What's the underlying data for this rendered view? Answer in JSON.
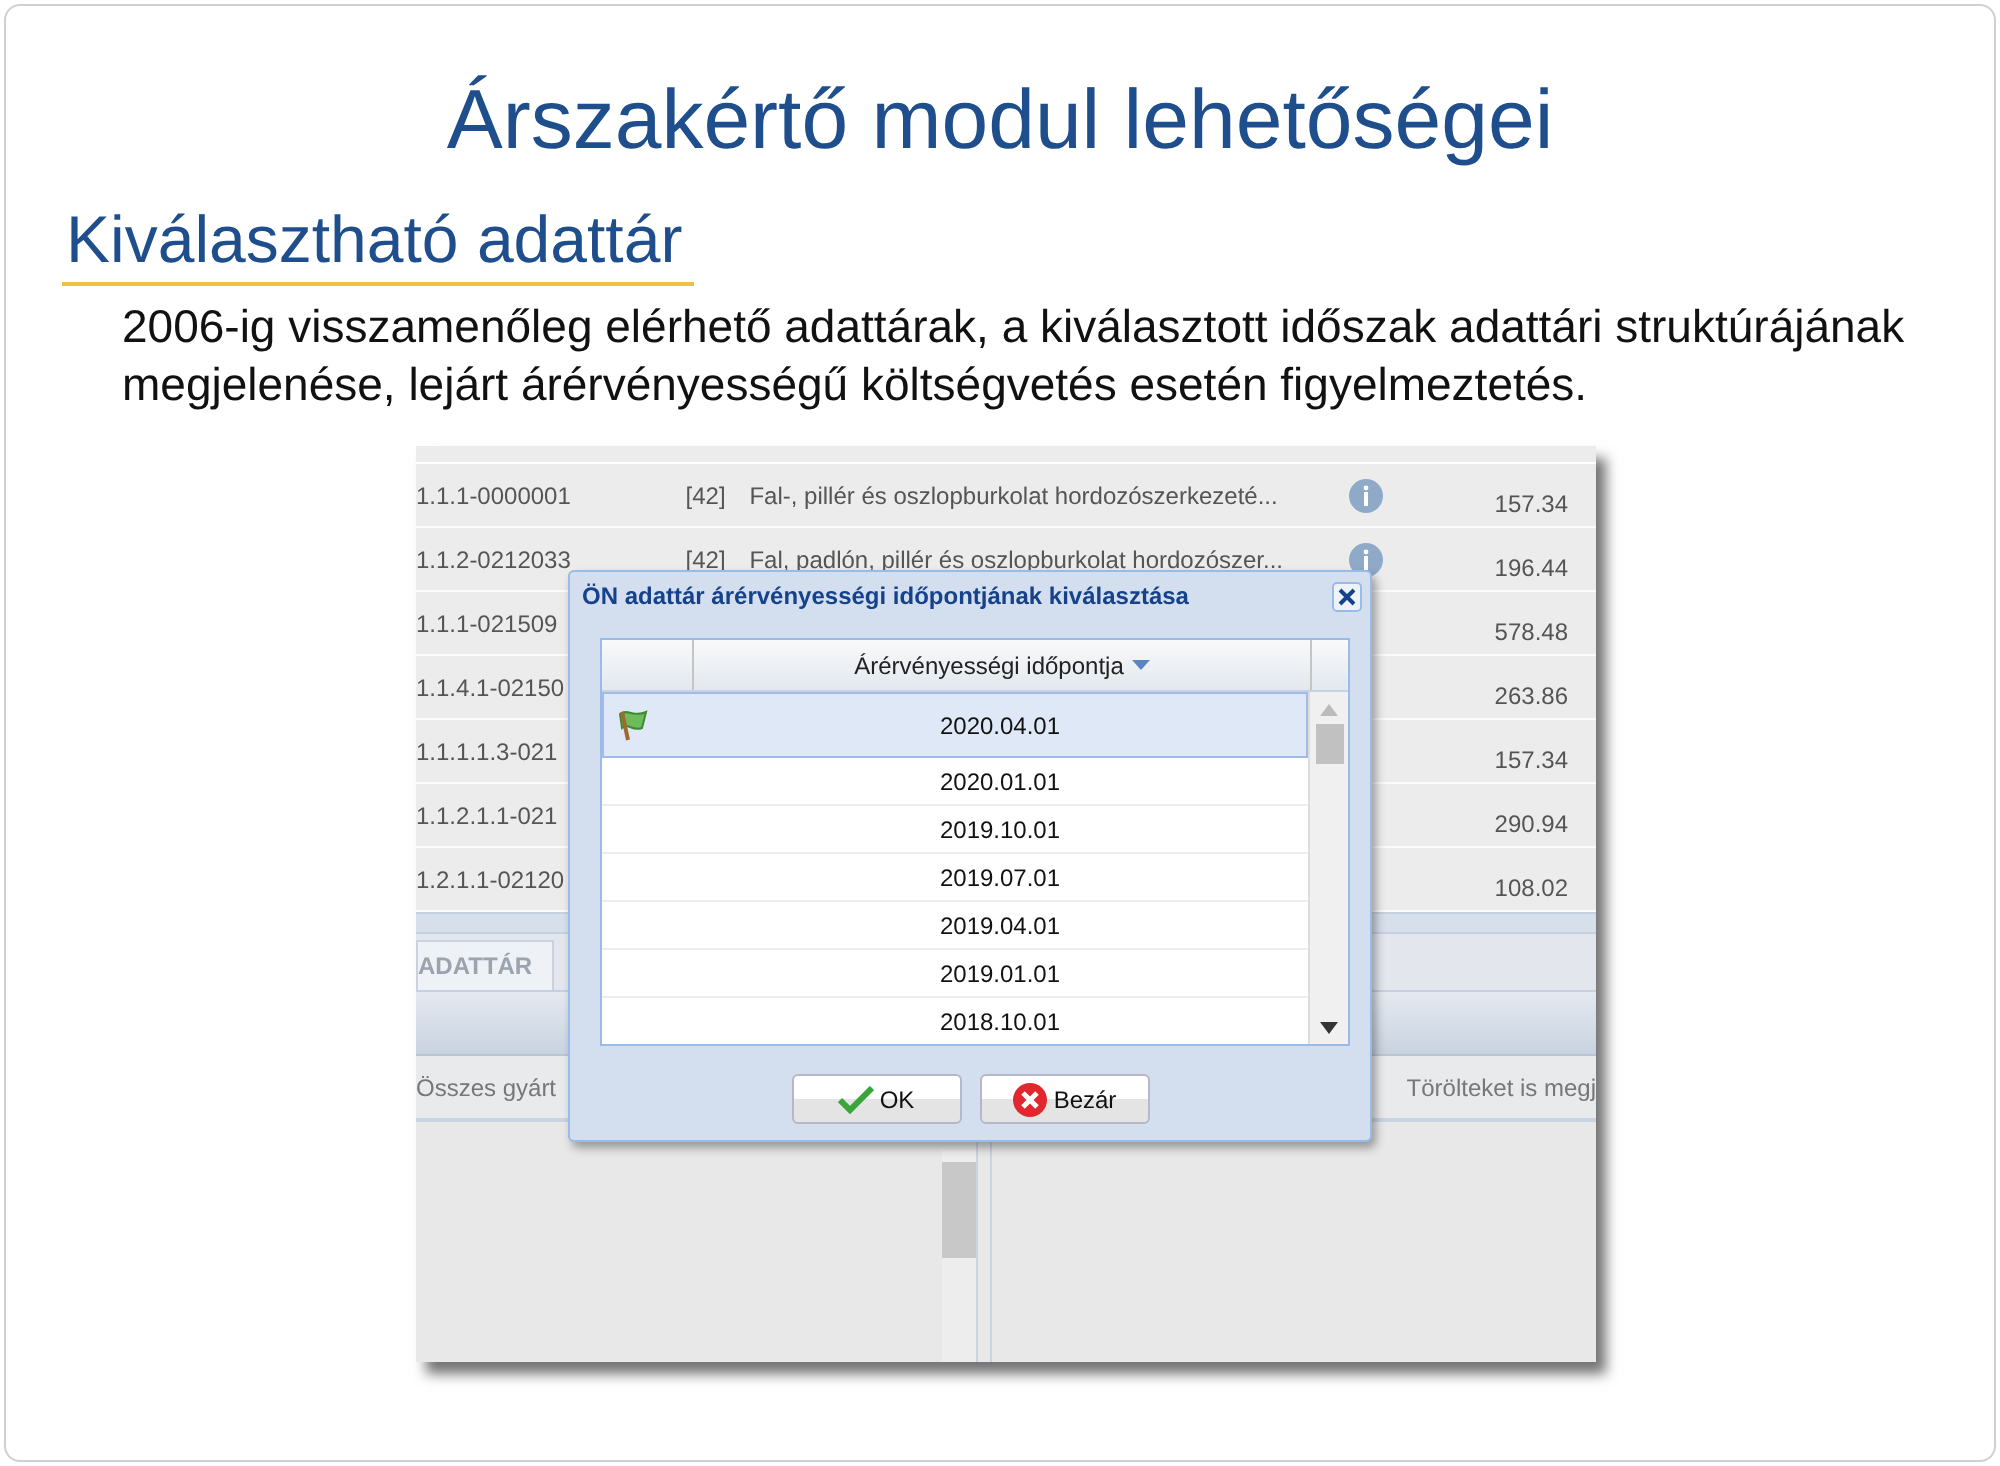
{
  "slide": {
    "title": "Árszakértő modul lehetőségei",
    "subtitle": "Kiválasztható adattár",
    "text": "2006-ig visszamenőleg elérhető adattárak, a kiválasztott időszak adattári struktúrájának megjelenése, lejárt árérvényességű költségvetés esetén figyelmeztetés."
  },
  "screenshot": {
    "rows": [
      {
        "code": "1.1.1-0000001",
        "group": "[42]",
        "description": "Fal-, pillér és oszlopburkolat hordozószerkezeté...",
        "price": "157.34"
      },
      {
        "code": "1.1.2-0212033",
        "group": "[42]",
        "description": "Fal, padlón, pillér és oszlopburkolat hordozószer...",
        "price": "196.44"
      },
      {
        "code": "1.1.1-021509",
        "price": "578.48"
      },
      {
        "code": "1.1.4.1-02150",
        "price": "263.86"
      },
      {
        "code": "1.1.1.1.3-021",
        "price": "157.34"
      },
      {
        "code": "1.1.2.1.1-021",
        "price": "290.94"
      },
      {
        "code": "1.2.1.1-02120",
        "price": "108.02"
      }
    ],
    "tab": "ADATTÁR",
    "filter_left": "Összes gyárt",
    "filter_right": "Törölteket is megj",
    "dialog": {
      "title": "ÖN adattár árérvényességi időpontjának kiválasztása",
      "column": "Árérvényességi időpontja",
      "rows": [
        {
          "date": "2020.04.01",
          "selected": true
        },
        {
          "date": "2020.01.01",
          "selected": false
        },
        {
          "date": "2019.10.01",
          "selected": false
        },
        {
          "date": "2019.07.01",
          "selected": false
        },
        {
          "date": "2019.04.01",
          "selected": false
        },
        {
          "date": "2019.01.01",
          "selected": false
        },
        {
          "date": "2018.10.01",
          "selected": false
        }
      ],
      "buttons": [
        {
          "kind": "ok",
          "label": "OK"
        },
        {
          "kind": "close",
          "label": "Bezár"
        }
      ]
    }
  }
}
